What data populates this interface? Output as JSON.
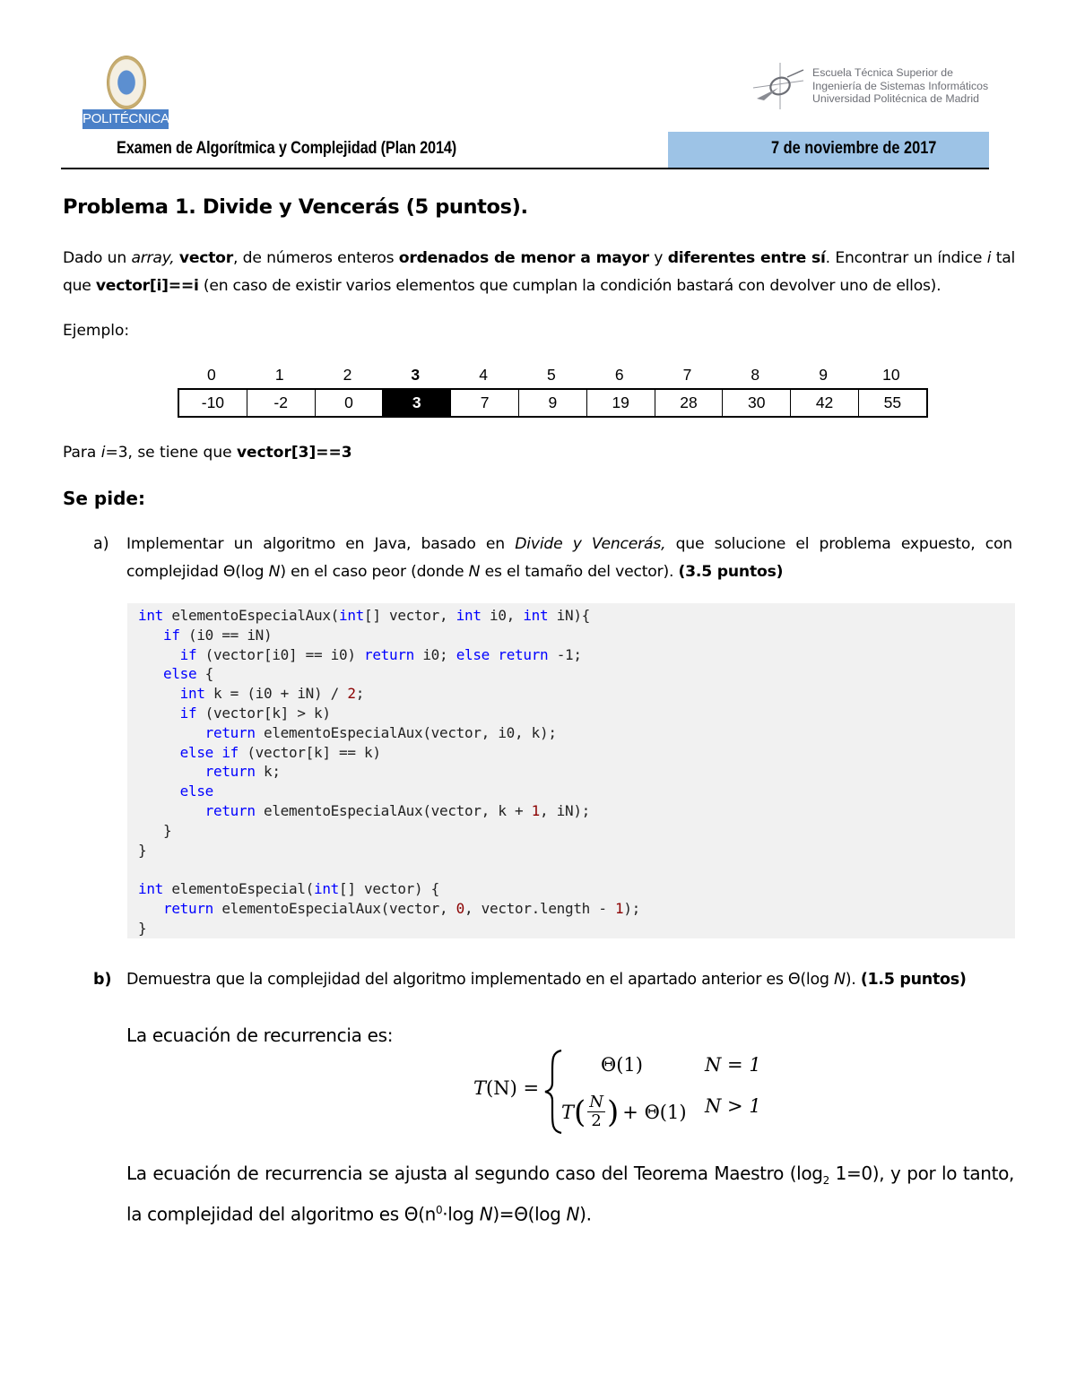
{
  "header": {
    "left_logo": {
      "icon": "upm-seal-icon",
      "banner_text": "POLITÉCNICA"
    },
    "right_logo": {
      "icon": "etsisi-logo-icon",
      "lines": [
        "Escuela Técnica Superior de",
        "Ingeniería de Sistemas Informáticos",
        "Universidad Politécnica de Madrid"
      ]
    },
    "exam_title": "Examen de Algorítmica y Complejidad (Plan 2014)",
    "exam_date": "7 de noviembre de 2017",
    "date_box_color": "#9dc3e6"
  },
  "problem": {
    "title": "Problema 1. Divide y Vencerás (5 puntos).",
    "statement": {
      "p1": "Dado un ",
      "p1_italic": "array,",
      "p2": " ",
      "p2_bold": "vector",
      "p3": ", de números enteros ",
      "p3_bold": "ordenados de menor a mayor",
      "p4": " y ",
      "p4_bold": "diferentes entre sí",
      "p5": ". Encontrar un índice ",
      "p5_italic": "i",
      "p6": " tal que ",
      "p6_bold": "vector[i]==i",
      "p7": " (en caso de existir varios elementos que cumplan la condición bastará con devolver uno de ellos)."
    },
    "example_label": "Ejemplo:",
    "example_array": {
      "indices": [
        "0",
        "1",
        "2",
        "3",
        "4",
        "5",
        "6",
        "7",
        "8",
        "9",
        "10"
      ],
      "values": [
        "-10",
        "-2",
        "0",
        "3",
        "7",
        "9",
        "19",
        "28",
        "30",
        "42",
        "55"
      ],
      "highlighted_index": 3
    },
    "example_result": {
      "p1": "Para ",
      "p1_italic": "i",
      "p2": "=3, se tiene que ",
      "p2_bold": "vector[3]==3"
    },
    "requests_label": "Se pide:"
  },
  "part_a": {
    "label": "a)",
    "text_1": "Implementar un algoritmo en Java, basado en ",
    "text_1_italic": "Divide y Vencerás,",
    "text_2": " que solucione el problema expuesto, con complejidad Θ(log ",
    "text_2_italic": "N",
    "text_3": ") en el caso peor (donde ",
    "text_3_italic": "N",
    "text_4": " es el tamaño del vector). ",
    "points": "(3.5 puntos)",
    "code_lines": [
      [
        [
          "kw",
          "int"
        ],
        [
          "t",
          " elementoEspecialAux("
        ],
        [
          "kw",
          "int"
        ],
        [
          "t",
          "[] vector, "
        ],
        [
          "kw",
          "int"
        ],
        [
          "t",
          " i0, "
        ],
        [
          "kw",
          "int"
        ],
        [
          "t",
          " iN){"
        ]
      ],
      [
        [
          "t",
          "   "
        ],
        [
          "kw",
          "if"
        ],
        [
          "t",
          " (i0 == iN)"
        ]
      ],
      [
        [
          "t",
          "     "
        ],
        [
          "kw",
          "if"
        ],
        [
          "t",
          " (vector[i0] == i0) "
        ],
        [
          "kw",
          "return"
        ],
        [
          "t",
          " i0; "
        ],
        [
          "kw",
          "else"
        ],
        [
          "t",
          " "
        ],
        [
          "kw",
          "return"
        ],
        [
          "t",
          " -1;"
        ]
      ],
      [
        [
          "t",
          "   "
        ],
        [
          "kw",
          "else"
        ],
        [
          "t",
          " {"
        ]
      ],
      [
        [
          "t",
          "     "
        ],
        [
          "kw",
          "int"
        ],
        [
          "t",
          " k = (i0 + iN) / "
        ],
        [
          "num",
          "2"
        ],
        [
          "t",
          ";"
        ]
      ],
      [
        [
          "t",
          "     "
        ],
        [
          "kw",
          "if"
        ],
        [
          "t",
          " (vector[k] > k)"
        ]
      ],
      [
        [
          "t",
          "        "
        ],
        [
          "kw",
          "return"
        ],
        [
          "t",
          " elementoEspecialAux(vector, i0, k);"
        ]
      ],
      [
        [
          "t",
          "     "
        ],
        [
          "kw",
          "else if"
        ],
        [
          "t",
          " (vector[k] == k)"
        ]
      ],
      [
        [
          "t",
          "        "
        ],
        [
          "kw",
          "return"
        ],
        [
          "t",
          " k;"
        ]
      ],
      [
        [
          "t",
          "     "
        ],
        [
          "kw",
          "else"
        ]
      ],
      [
        [
          "t",
          "        "
        ],
        [
          "kw",
          "return"
        ],
        [
          "t",
          " elementoEspecialAux(vector, k + "
        ],
        [
          "num",
          "1"
        ],
        [
          "t",
          ", iN);"
        ]
      ],
      [
        [
          "t",
          "   }"
        ]
      ],
      [
        [
          "t",
          "}"
        ]
      ],
      [
        [
          "t",
          ""
        ]
      ],
      [
        [
          "kw",
          "int"
        ],
        [
          "t",
          " elementoEspecial("
        ],
        [
          "kw",
          "int"
        ],
        [
          "t",
          "[] vector) {"
        ]
      ],
      [
        [
          "t",
          "   "
        ],
        [
          "kw",
          "return"
        ],
        [
          "t",
          " elementoEspecialAux(vector, "
        ],
        [
          "num",
          "0"
        ],
        [
          "t",
          ", vector.length - "
        ],
        [
          "num",
          "1"
        ],
        [
          "t",
          ");"
        ]
      ],
      [
        [
          "t",
          "}"
        ]
      ]
    ],
    "code_colors": {
      "keyword": "#0000ff",
      "number": "#8b0000",
      "background": "#f1f1f1"
    }
  },
  "part_b": {
    "label": "b)",
    "text_1": "Demuestra que la complejidad del algoritmo implementado en el apartado anterior es Θ(log ",
    "text_1_italic": "N",
    "text_2": "). ",
    "points": "(1.5 puntos)",
    "recurrence_label": "La ecuación de recurrencia es:",
    "formula": {
      "lhs_T": "T",
      "lhs_arg": "(N) =",
      "case1_expr": "Θ(1)",
      "case1_cond": "N = 1",
      "case2_T": "T",
      "case2_num": "N",
      "case2_den": "2",
      "case2_rest": "+ Θ(1)",
      "case2_cond": "N > 1"
    },
    "conclusion": {
      "p1": "La ecuación de recurrencia se ajusta al segundo caso del Teorema Maestro (log",
      "p1_sub": "2",
      "p2": " 1=0), y por lo tanto, la complejidad del algoritmo es Θ(n",
      "p2_sup": "0",
      "p3": "·log ",
      "p3_italic": "N",
      "p4": ")=Θ(log ",
      "p4_italic": "N",
      "p5": ")."
    }
  }
}
